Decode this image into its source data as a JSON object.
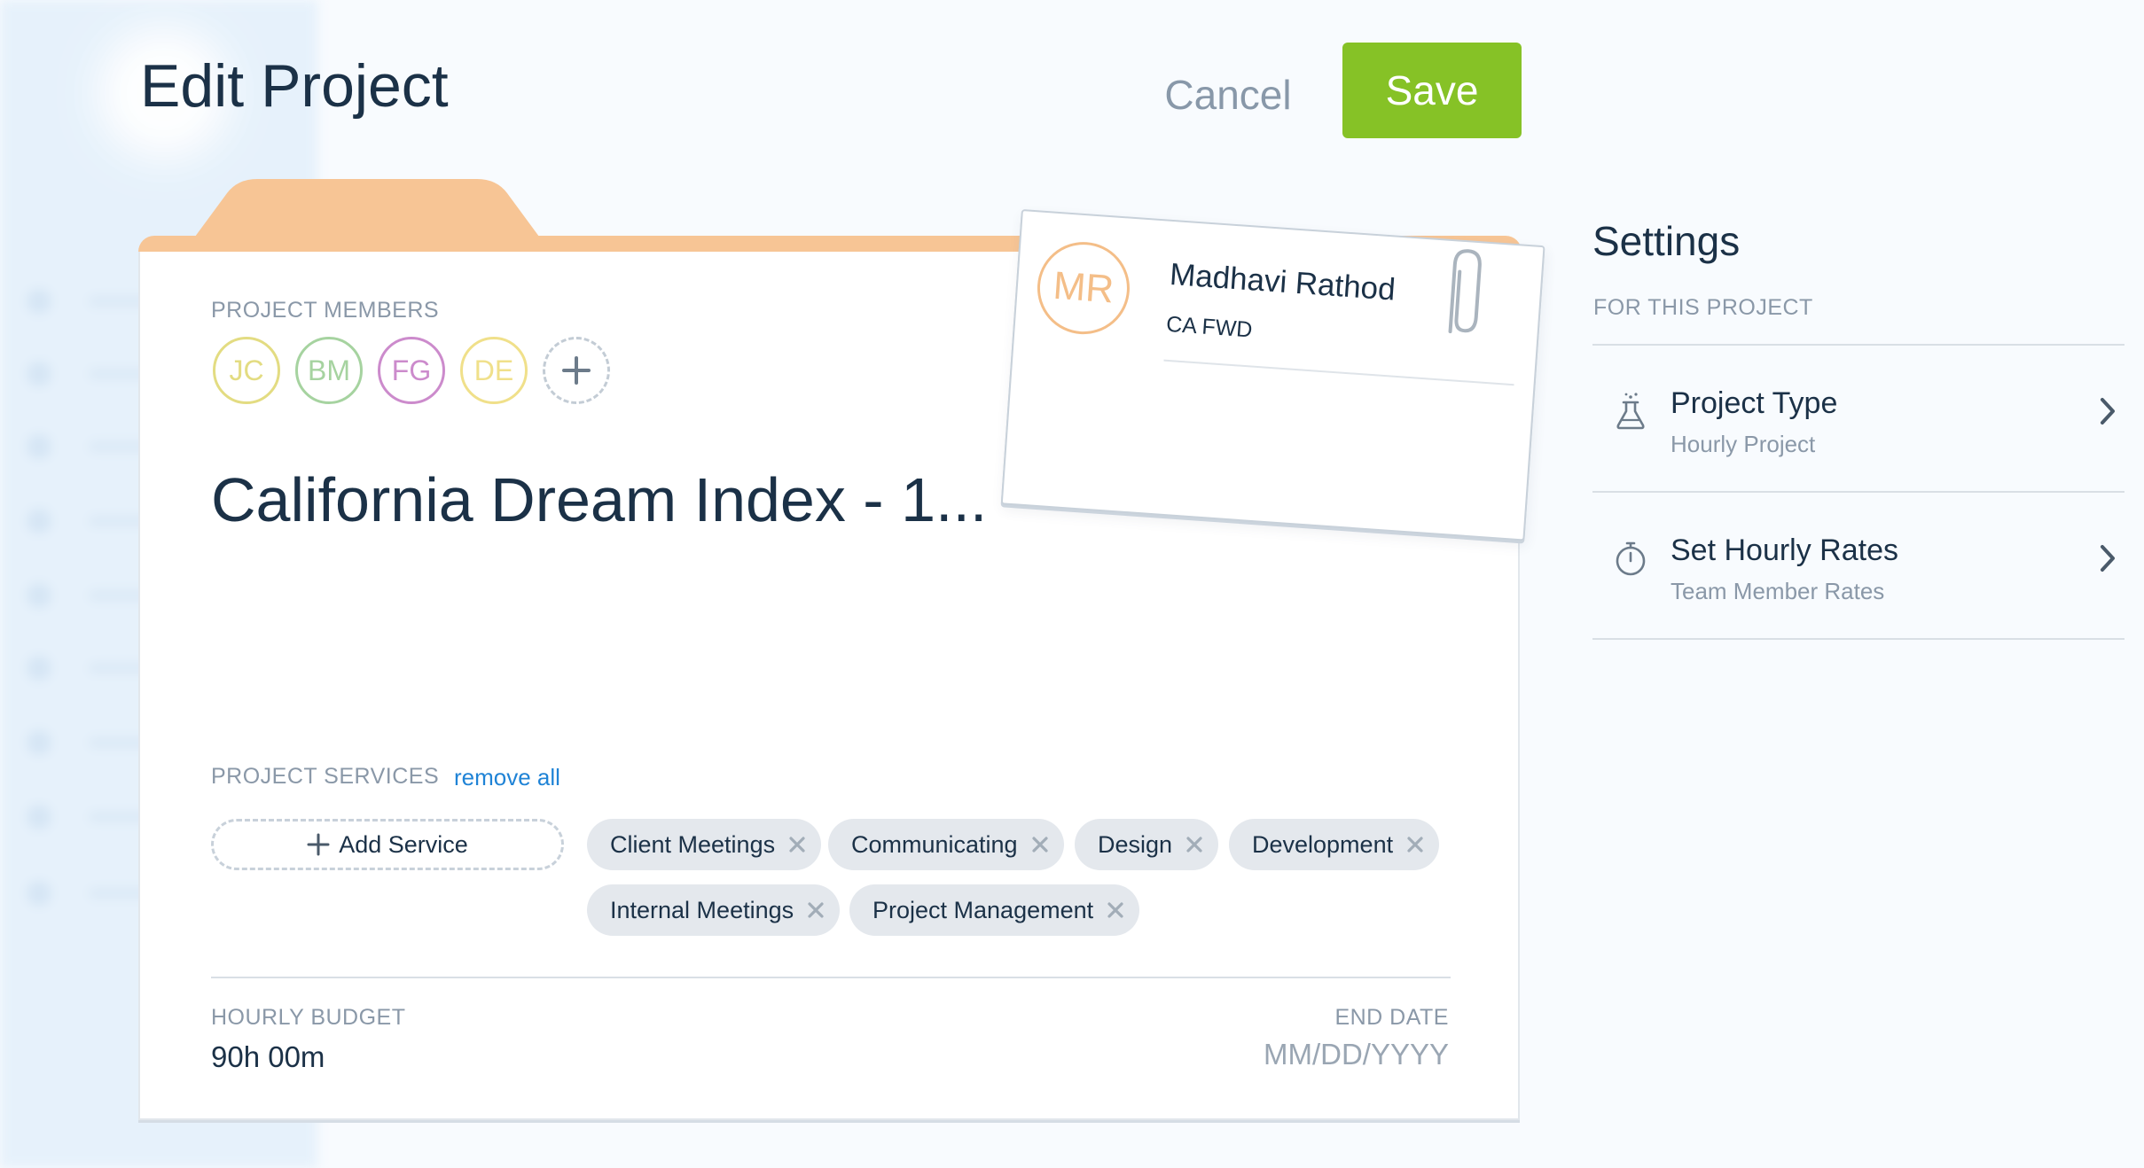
{
  "header": {
    "title": "Edit Project",
    "cancel_label": "Cancel",
    "save_label": "Save"
  },
  "colors": {
    "accent_green": "#86c226",
    "folder_orange": "#f7c595",
    "link_blue": "#1f83d6",
    "text_dark": "#1b3147",
    "text_muted": "#8a98a8"
  },
  "project": {
    "members_label": "PROJECT MEMBERS",
    "members": [
      {
        "initials": "JC",
        "color": "#e3dc82"
      },
      {
        "initials": "BM",
        "color": "#a6d3a0"
      },
      {
        "initials": "FG",
        "color": "#cc8bcc"
      },
      {
        "initials": "DE",
        "color": "#f0e08a"
      }
    ],
    "add_member_icon": "plus-icon",
    "name": "California Dream Index - 1...",
    "services_label": "PROJECT SERVICES",
    "remove_all_label": "remove all",
    "add_service_label": "Add Service",
    "services": [
      "Client Meetings",
      "Communicating",
      "Design",
      "Development",
      "Internal Meetings",
      "Project Management"
    ],
    "budget_label": "HOURLY BUDGET",
    "budget_value": "90h 00m",
    "end_date_label": "END DATE",
    "end_date_value": "",
    "end_date_placeholder": "MM/DD/YYYY"
  },
  "member_card": {
    "initials": "MR",
    "name": "Madhavi Rathod",
    "role": "CA FWD",
    "icon": "paperclip-icon"
  },
  "settings": {
    "title": "Settings",
    "subtitle": "FOR THIS PROJECT",
    "items": [
      {
        "title": "Project Type",
        "subtitle": "Hourly Project",
        "icon": "flask-icon"
      },
      {
        "title": "Set Hourly Rates",
        "subtitle": "Team Member Rates",
        "icon": "stopwatch-icon"
      }
    ]
  }
}
